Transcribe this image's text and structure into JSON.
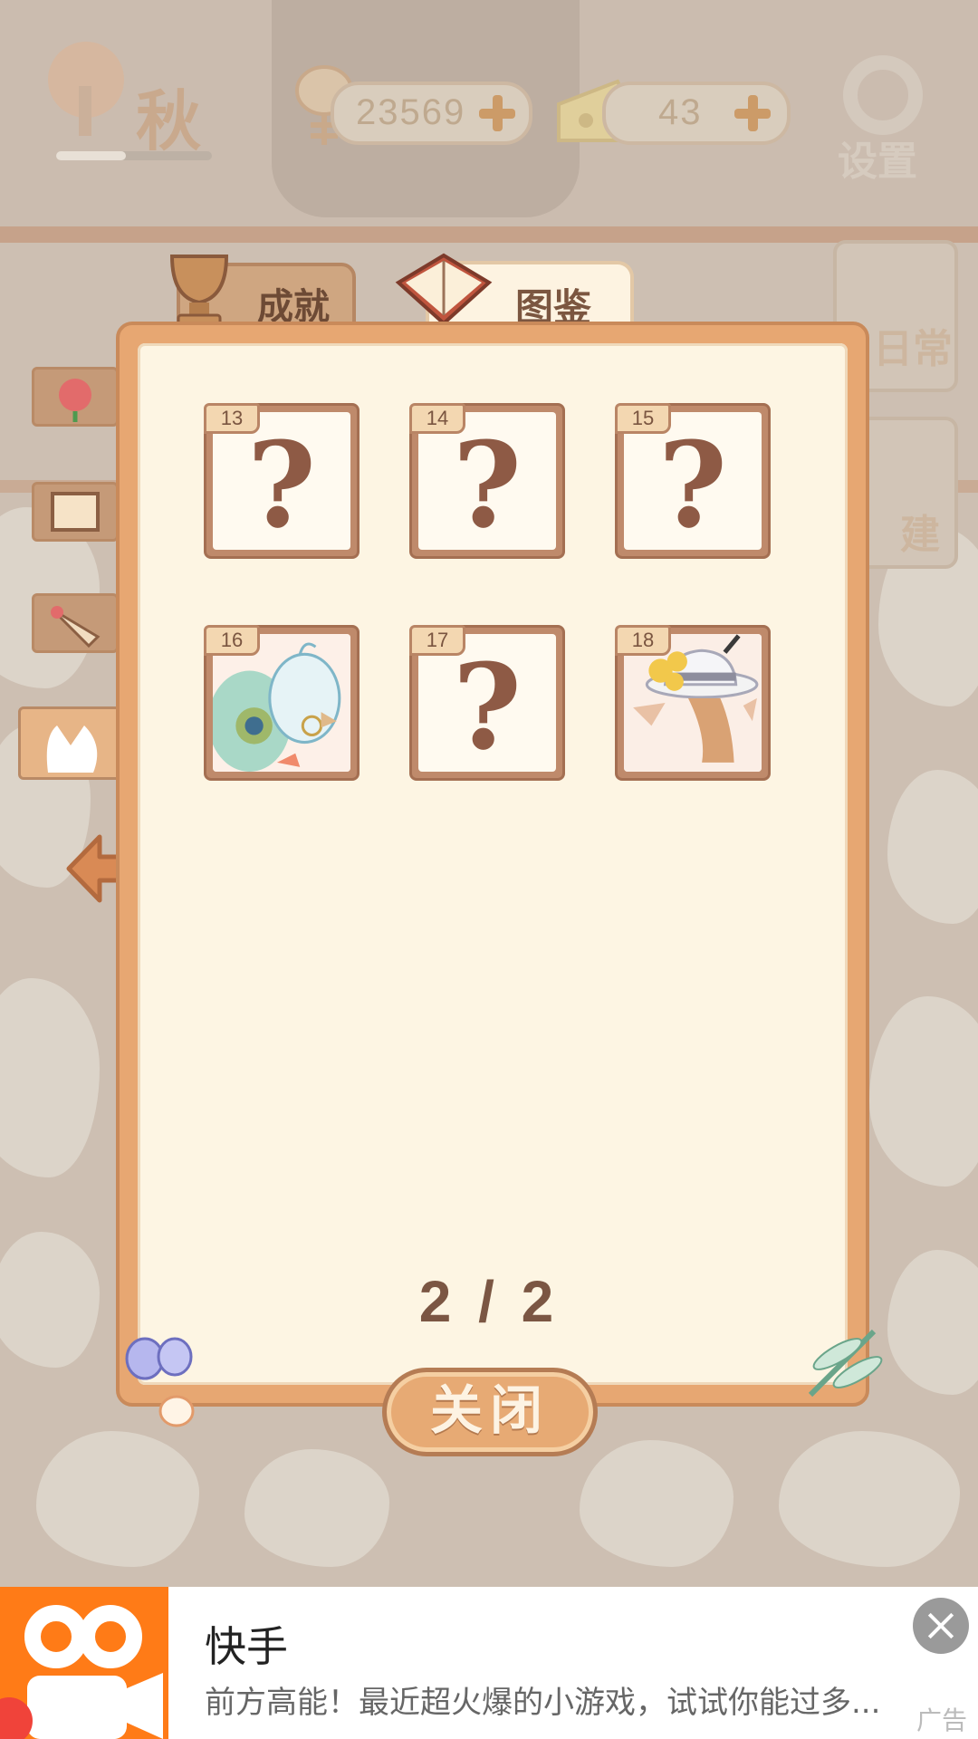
{
  "hud": {
    "season": "秋",
    "season_progress": 0.45,
    "fish_count": "23569",
    "cheese_count": "43",
    "settings_label": "设置"
  },
  "right_buttons": {
    "daily": "日常",
    "build": "建"
  },
  "tabs": {
    "achievements": "成就",
    "collection": "图鉴"
  },
  "collection": {
    "cards": [
      {
        "number": "13",
        "unlocked": false,
        "placeholder": "?"
      },
      {
        "number": "14",
        "unlocked": false,
        "placeholder": "?"
      },
      {
        "number": "15",
        "unlocked": false,
        "placeholder": "?"
      },
      {
        "number": "16",
        "unlocked": true,
        "icon": "peacock-portrait-icon"
      },
      {
        "number": "17",
        "unlocked": false,
        "placeholder": "?"
      },
      {
        "number": "18",
        "unlocked": true,
        "icon": "deer-lady-portrait-icon"
      }
    ],
    "page_indicator": "2 / 2",
    "close_label": "关闭"
  },
  "ad": {
    "title": "快手",
    "description": "前方高能！最近超火爆的小游戏，试试你能过多...",
    "tag": "广告",
    "accent_color": "#ff7b17"
  },
  "colors": {
    "panel_border": "#e7a772",
    "panel_inner": "#fdf5e3",
    "card_frame": "#bf8a6b",
    "question_mark": "#8e5a45"
  }
}
